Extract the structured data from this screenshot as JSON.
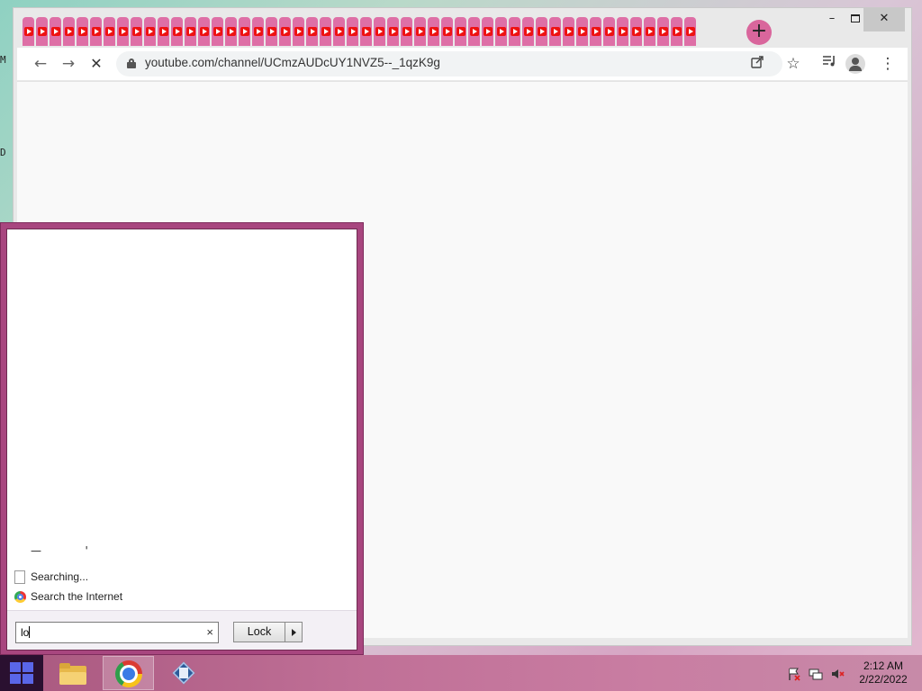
{
  "desktop": {
    "glyphs": [
      "M",
      "D"
    ]
  },
  "browser": {
    "tab_count": 50,
    "tab_color": "#de6fa6",
    "favicon": "youtube-icon",
    "new_tab_label": "+",
    "window_controls": {
      "minimize": "–",
      "close": "✕"
    },
    "nav": {
      "back": "←",
      "forward": "→",
      "stop": "✕"
    },
    "url": "youtube.com/channel/UCmzAUDcUY1NVZ5--_1qzK9g",
    "toolbar_icons": {
      "share": "share-icon",
      "bookmark": "☆",
      "media": "media-control-icon",
      "menu": "⋮"
    }
  },
  "start_menu": {
    "results": [
      {
        "icon": "document-icon",
        "label": "Searching..."
      },
      {
        "icon": "chrome-icon",
        "label": "Search the Internet"
      }
    ],
    "search": {
      "value": "lo",
      "clear_label": "×"
    },
    "power_button_label": "Lock",
    "accent": "#a8467f"
  },
  "taskbar": {
    "apps": [
      {
        "name": "file-explorer",
        "active": false
      },
      {
        "name": "chrome",
        "active": true
      },
      {
        "name": "virtualbox",
        "active": false
      }
    ],
    "tray": [
      "action-center-flag-icon",
      "network-icon",
      "volume-muted-icon"
    ],
    "clock": {
      "time": "2:12 AM",
      "date": "2/22/2022"
    }
  }
}
